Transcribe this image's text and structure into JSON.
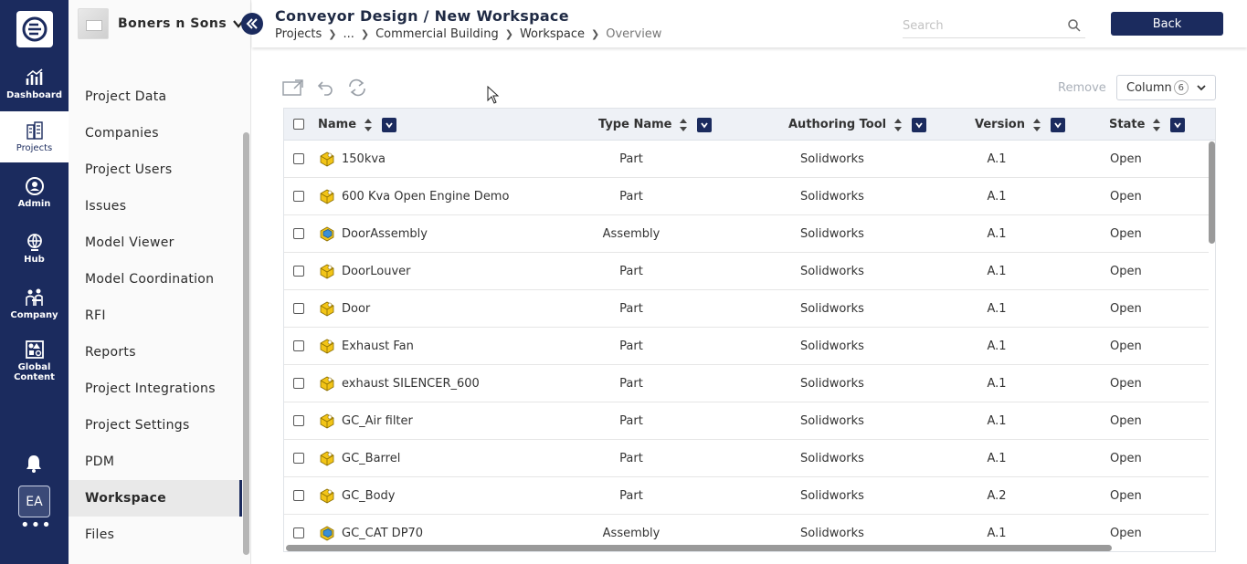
{
  "rail": {
    "items": [
      {
        "label": "Dashboard",
        "icon": "bar-chart-icon"
      },
      {
        "label": "Projects",
        "icon": "buildings-icon",
        "active": true
      },
      {
        "label": "Admin",
        "icon": "user-circle-icon"
      },
      {
        "label": "Hub",
        "icon": "globe-icon"
      },
      {
        "label": "Company",
        "icon": "company-people-icon"
      },
      {
        "label": "Global\nContent",
        "icon": "shapes-icon"
      }
    ],
    "avatar": "EA",
    "more": "•••"
  },
  "sidebar": {
    "org_name": "Boners n Sons",
    "items": [
      {
        "label": "Project Data"
      },
      {
        "label": "Companies"
      },
      {
        "label": "Project Users"
      },
      {
        "label": "Issues"
      },
      {
        "label": "Model Viewer"
      },
      {
        "label": "Model Coordination"
      },
      {
        "label": "RFI"
      },
      {
        "label": "Reports"
      },
      {
        "label": "Project Integrations"
      },
      {
        "label": "Project Settings"
      },
      {
        "label": "PDM"
      },
      {
        "label": "Workspace",
        "active": true
      },
      {
        "label": "Files"
      }
    ]
  },
  "header": {
    "title": "Conveyor Design / New Workspace",
    "breadcrumbs": [
      "Projects",
      "...",
      "Commercial Building",
      "Workspace",
      "Overview"
    ],
    "search_placeholder": "Search",
    "back_label": "Back"
  },
  "toolbar": {
    "remove_label": "Remove",
    "column_label": "Column",
    "column_count": "6"
  },
  "grid": {
    "columns": [
      "Name",
      "Type Name",
      "Authoring Tool",
      "Version",
      "State"
    ],
    "rows": [
      {
        "name": "150kva",
        "type": "Part",
        "tool": "Solidworks",
        "version": "A.1",
        "state": "Open"
      },
      {
        "name": "600 Kva Open Engine Demo",
        "type": "Part",
        "tool": "Solidworks",
        "version": "A.1",
        "state": "Open"
      },
      {
        "name": "DoorAssembly",
        "type": "Assembly",
        "tool": "Solidworks",
        "version": "A.1",
        "state": "Open"
      },
      {
        "name": "DoorLouver",
        "type": "Part",
        "tool": "Solidworks",
        "version": "A.1",
        "state": "Open"
      },
      {
        "name": "Door",
        "type": "Part",
        "tool": "Solidworks",
        "version": "A.1",
        "state": "Open"
      },
      {
        "name": "Exhaust Fan",
        "type": "Part",
        "tool": "Solidworks",
        "version": "A.1",
        "state": "Open"
      },
      {
        "name": "exhaust SILENCER_600",
        "type": "Part",
        "tool": "Solidworks",
        "version": "A.1",
        "state": "Open"
      },
      {
        "name": "GC_Air filter",
        "type": "Part",
        "tool": "Solidworks",
        "version": "A.1",
        "state": "Open"
      },
      {
        "name": "GC_Barrel",
        "type": "Part",
        "tool": "Solidworks",
        "version": "A.1",
        "state": "Open"
      },
      {
        "name": "GC_Body",
        "type": "Part",
        "tool": "Solidworks",
        "version": "A.2",
        "state": "Open"
      },
      {
        "name": "GC_CAT DP70",
        "type": "Assembly",
        "tool": "Solidworks",
        "version": "A.1",
        "state": "Open"
      }
    ]
  },
  "colors": {
    "navy": "#1b2b5e",
    "part_yellow": "#f2c417",
    "assembly_blue": "#3a8fd6"
  }
}
